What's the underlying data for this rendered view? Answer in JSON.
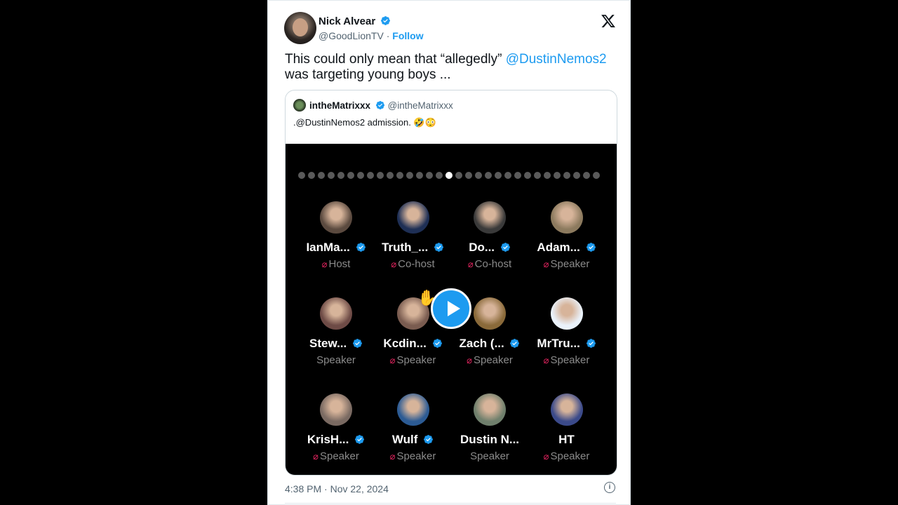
{
  "author": {
    "name": "Nick Alvear",
    "handle": "@GoodLionTV",
    "separator": "·",
    "follow_label": "Follow"
  },
  "tweet": {
    "text_before": "This could only mean that  “allegedly” ",
    "mention": "@DustinNemos2",
    "text_after": "was targeting young boys ..."
  },
  "quote": {
    "name": "intheMatrixxx",
    "handle": "@intheMatrixxx",
    "text": ".@DustinNemos2 admission. 🤣😳",
    "dots_total": 31,
    "dots_active_index": 15
  },
  "participants": [
    {
      "name": "IanMa...",
      "role": "Host",
      "verified": true,
      "muted": true,
      "avatar_color": "#5b4a3f"
    },
    {
      "name": "Truth_...",
      "role": "Co-host",
      "verified": true,
      "muted": true,
      "avatar_color": "#1e2f55"
    },
    {
      "name": "Do...",
      "role": "Co-host",
      "verified": true,
      "muted": true,
      "avatar_color": "#3a3a3a"
    },
    {
      "name": "Adam...",
      "role": "Speaker",
      "verified": true,
      "muted": true,
      "avatar_color": "#8c7a5e"
    },
    {
      "name": "Stew...",
      "role": "Speaker",
      "verified": true,
      "muted": false,
      "avatar_color": "#6e4b46"
    },
    {
      "name": "Kcdin...",
      "role": "Speaker",
      "verified": true,
      "muted": true,
      "avatar_color": "#7a5c50"
    },
    {
      "name": "Zach (...",
      "role": "Speaker",
      "verified": true,
      "muted": true,
      "avatar_color": "#8a6a3a"
    },
    {
      "name": "MrTru...",
      "role": "Speaker",
      "verified": true,
      "muted": true,
      "avatar_color": "#eaf2fb"
    },
    {
      "name": "KrisH...",
      "role": "Speaker",
      "verified": true,
      "muted": true,
      "avatar_color": "#7a6a62"
    },
    {
      "name": "Wulf",
      "role": "Speaker",
      "verified": true,
      "muted": true,
      "avatar_color": "#2c5b94"
    },
    {
      "name": "Dustin N...",
      "role": "Speaker",
      "verified": false,
      "muted": false,
      "avatar_color": "#6f7f6c"
    },
    {
      "name": "HT",
      "role": "Speaker",
      "verified": false,
      "muted": true,
      "avatar_color": "#3b4a8a"
    }
  ],
  "timestamp": "4:38 PM · Nov 22, 2024",
  "colors": {
    "accent": "#1d9bf0",
    "muted_mic": "#e0245e"
  },
  "icons": {
    "close": "x-logo-icon",
    "info": "info-icon",
    "play": "play-icon",
    "hand": "raised-hand-icon"
  }
}
